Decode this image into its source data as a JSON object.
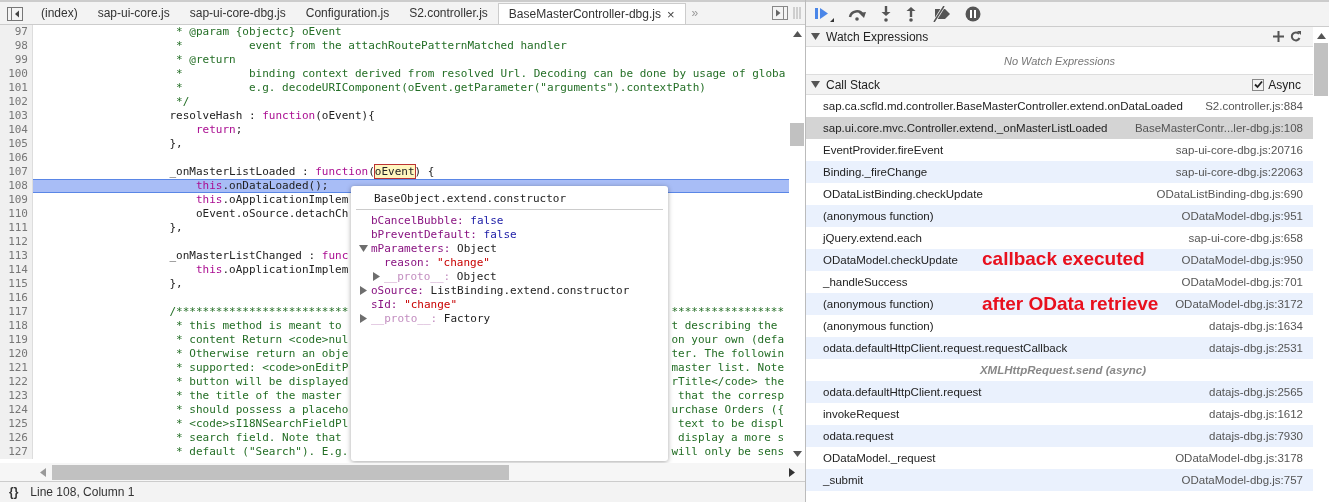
{
  "editor": {
    "tabs": [
      {
        "label": "(index)",
        "selected": false
      },
      {
        "label": "sap-ui-core.js",
        "selected": false
      },
      {
        "label": "sap-ui-core-dbg.js",
        "selected": false
      },
      {
        "label": "Configuration.js",
        "selected": false
      },
      {
        "label": "S2.controller.js",
        "selected": false
      },
      {
        "label": "BaseMasterController-dbg.js",
        "selected": true,
        "close_label": "×"
      }
    ],
    "tab_overflow": "»",
    "lines": [
      {
        "number": "97",
        "highlighted": false,
        "segments": [
          {
            "kind": "comment",
            "text": "                     * @param {objectc} oEvent"
          }
        ]
      },
      {
        "number": "98",
        "highlighted": false,
        "segments": [
          {
            "kind": "comment",
            "text": "                     *          event from the attachRoutePatternMatched handler"
          }
        ]
      },
      {
        "number": "99",
        "highlighted": false,
        "segments": [
          {
            "kind": "comment",
            "text": "                     * @return"
          }
        ]
      },
      {
        "number": "100",
        "highlighted": false,
        "segments": [
          {
            "kind": "comment",
            "text": "                     *          binding context derived from resolved Url. Decoding can be done by usage of globa"
          }
        ]
      },
      {
        "number": "101",
        "highlighted": false,
        "segments": [
          {
            "kind": "comment",
            "text": "                     *          e.g. decodeURIComponent(oEvent.getParameter(\"arguments\").contextPath)"
          }
        ]
      },
      {
        "number": "102",
        "highlighted": false,
        "segments": [
          {
            "kind": "comment",
            "text": "                     */"
          }
        ]
      },
      {
        "number": "103",
        "highlighted": false,
        "segments": [
          {
            "kind": "plain",
            "text": "                    resolveHash : "
          },
          {
            "kind": "keyword",
            "text": "function"
          },
          {
            "kind": "plain",
            "text": "(oEvent){"
          }
        ]
      },
      {
        "number": "104",
        "highlighted": false,
        "segments": [
          {
            "kind": "keyword",
            "text": "                        return"
          },
          {
            "kind": "plain",
            "text": ";"
          }
        ]
      },
      {
        "number": "105",
        "highlighted": false,
        "segments": [
          {
            "kind": "plain",
            "text": "                    },"
          }
        ]
      },
      {
        "number": "106",
        "highlighted": false
      },
      {
        "number": "107",
        "highlighted": false,
        "segments": [
          {
            "kind": "plain",
            "text": "                    _onMasterListLoaded : "
          },
          {
            "kind": "keyword",
            "text": "function"
          },
          {
            "kind": "plain",
            "text": "("
          },
          {
            "kind": "hover",
            "text": "oEvent"
          },
          {
            "kind": "plain",
            "text": ") {"
          }
        ]
      },
      {
        "number": "108",
        "highlighted": true,
        "segments": [
          {
            "kind": "keyword",
            "text": "                        this"
          },
          {
            "kind": "plain",
            "text": ".onDataLoaded();"
          }
        ]
      },
      {
        "number": "109",
        "highlighted": false,
        "segments": [
          {
            "kind": "keyword",
            "text": "                        this"
          },
          {
            "kind": "plain",
            "text": ".oApplicationImplem"
          }
        ]
      },
      {
        "number": "110",
        "highlighted": false,
        "segments": [
          {
            "kind": "plain",
            "text": "                        oEvent.oSource.detachCh"
          }
        ]
      },
      {
        "number": "111",
        "highlighted": false,
        "segments": [
          {
            "kind": "plain",
            "text": "                    },"
          }
        ]
      },
      {
        "number": "112",
        "highlighted": false
      },
      {
        "number": "113",
        "highlighted": false,
        "segments": [
          {
            "kind": "plain",
            "text": "                    _onMasterListChanged : "
          },
          {
            "kind": "keyword",
            "text": "func"
          }
        ]
      },
      {
        "number": "114",
        "highlighted": false,
        "segments": [
          {
            "kind": "keyword",
            "text": "                        this"
          },
          {
            "kind": "plain",
            "text": ".oApplicationImplem"
          }
        ]
      },
      {
        "number": "115",
        "highlighted": false,
        "segments": [
          {
            "kind": "plain",
            "text": "                    },"
          }
        ]
      },
      {
        "number": "116",
        "highlighted": false
      },
      {
        "number": "117",
        "highlighted": false,
        "segments": [
          {
            "kind": "comment",
            "text": "                    /**************************"
          }
        ],
        "right": "*****************"
      },
      {
        "number": "118",
        "highlighted": false,
        "segments": [
          {
            "kind": "comment",
            "text": "                     * this method is meant to"
          }
        ],
        "right": "t describing the"
      },
      {
        "number": "119",
        "highlighted": false,
        "segments": [
          {
            "kind": "comment",
            "text": "                     * content Return <code>nul"
          }
        ],
        "right": "on your own (defa"
      },
      {
        "number": "120",
        "highlighted": false,
        "segments": [
          {
            "kind": "comment",
            "text": "                     * Otherwise return an obje"
          }
        ],
        "right": "ter. The followin"
      },
      {
        "number": "121",
        "highlighted": false,
        "segments": [
          {
            "kind": "comment",
            "text": "                     * supported: <code>onEditP"
          }
        ],
        "right": "master list. Note"
      },
      {
        "number": "122",
        "highlighted": false,
        "segments": [
          {
            "kind": "comment",
            "text": "                     * button will be displayed"
          }
        ],
        "right": "rTitle</code> the"
      },
      {
        "number": "123",
        "highlighted": false,
        "segments": [
          {
            "kind": "comment",
            "text": "                     * the title of the master"
          }
        ],
        "right": " that the corresp"
      },
      {
        "number": "124",
        "highlighted": false,
        "segments": [
          {
            "kind": "comment",
            "text": "                     * should possess a placeho"
          }
        ],
        "right": "urchase Orders ({"
      },
      {
        "number": "125",
        "highlighted": false,
        "segments": [
          {
            "kind": "comment",
            "text": "                     * <code>sI18NSearchFieldPl"
          }
        ],
        "right": " text to be displ"
      },
      {
        "number": "126",
        "highlighted": false,
        "segments": [
          {
            "kind": "comment",
            "text": "                     * search field. Note that"
          }
        ],
        "right": " display a more s"
      },
      {
        "number": "127",
        "highlighted": false,
        "segments": [
          {
            "kind": "comment",
            "text": "                     * default (\"Search\"). E.g."
          }
        ],
        "right": "will only be sens"
      }
    ],
    "popover": {
      "title": "BaseObject.extend.constructor",
      "properties": [
        {
          "name": "bCancelBubble:",
          "value": "false",
          "kind": "boolean",
          "internal": false,
          "expandable": false
        },
        {
          "name": "bPreventDefault:",
          "value": "false",
          "kind": "boolean",
          "internal": false,
          "expandable": false
        },
        {
          "name": "mParameters:",
          "value": "Object",
          "kind": "object",
          "internal": false,
          "expandable": true,
          "expanded": true,
          "children": [
            {
              "name": "reason:",
              "value": "\"change\"",
              "kind": "string",
              "internal": false,
              "expandable": false
            },
            {
              "name": "__proto__:",
              "value": "Object",
              "kind": "object",
              "internal": true,
              "expandable": true,
              "expanded": false
            }
          ]
        },
        {
          "name": "oSource:",
          "value": "ListBinding.extend.constructor",
          "kind": "object",
          "internal": false,
          "expandable": true,
          "expanded": false
        },
        {
          "name": "sId:",
          "value": "\"change\"",
          "kind": "string",
          "internal": false,
          "expandable": false
        },
        {
          "name": "__proto__:",
          "value": "Factory",
          "kind": "object",
          "internal": true,
          "expandable": true,
          "expanded": false
        }
      ]
    },
    "status_bar": {
      "pretty_print": "{}",
      "cursor": "Line 108, Column 1"
    }
  },
  "debugger": {
    "watch": {
      "title": "Watch Expressions",
      "expanded": true,
      "empty_text": "No Watch Expressions"
    },
    "call_stack": {
      "title": "Call Stack",
      "expanded": true,
      "async": {
        "label": "Async",
        "checked": true
      },
      "frames": [
        {
          "kind": "frame",
          "function": "sap.ca.scfld.md.controller.BaseMasterController.extend.onDataLoaded",
          "location": "S2.controller.js:884",
          "selected": false
        },
        {
          "kind": "frame",
          "function": "sap.ui.core.mvc.Controller.extend._onMasterListLoaded",
          "location": "BaseMasterContr...ler-dbg.js:108",
          "selected": true
        },
        {
          "kind": "frame",
          "function": "EventProvider.fireEvent",
          "location": "sap-ui-core-dbg.js:20716",
          "selected": false
        },
        {
          "kind": "frame",
          "function": "Binding._fireChange",
          "location": "sap-ui-core-dbg.js:22063",
          "selected": false
        },
        {
          "kind": "frame",
          "function": "ODataListBinding.checkUpdate",
          "location": "ODataListBinding-dbg.js:690",
          "selected": false
        },
        {
          "kind": "frame",
          "function": "(anonymous function)",
          "location": "ODataModel-dbg.js:951",
          "selected": false
        },
        {
          "kind": "frame",
          "function": "jQuery.extend.each",
          "location": "sap-ui-core-dbg.js:658",
          "selected": false
        },
        {
          "kind": "frame",
          "function": "ODataModel.checkUpdate",
          "location": "ODataModel-dbg.js:950",
          "selected": false
        },
        {
          "kind": "frame",
          "function": "_handleSuccess",
          "location": "ODataModel-dbg.js:701",
          "selected": false
        },
        {
          "kind": "frame",
          "function": "(anonymous function)",
          "location": "ODataModel-dbg.js:3172",
          "selected": false
        },
        {
          "kind": "frame",
          "function": "(anonymous function)",
          "location": "datajs-dbg.js:1634",
          "selected": false
        },
        {
          "kind": "frame",
          "function": "odata.defaultHttpClient.request.requestCallback",
          "location": "datajs-dbg.js:2531",
          "selected": false
        },
        {
          "kind": "async",
          "label": "XMLHttpRequest.send (async)",
          "selected": false
        },
        {
          "kind": "frame",
          "function": "odata.defaultHttpClient.request",
          "location": "datajs-dbg.js:2565",
          "selected": false
        },
        {
          "kind": "frame",
          "function": "invokeRequest",
          "location": "datajs-dbg.js:1612",
          "selected": false
        },
        {
          "kind": "frame",
          "function": "odata.request",
          "location": "datajs-dbg.js:7930",
          "selected": false
        },
        {
          "kind": "frame",
          "function": "ODataModel._request",
          "location": "ODataModel-dbg.js:3178",
          "selected": false
        },
        {
          "kind": "frame",
          "function": "_submit",
          "location": "ODataModel-dbg.js:757",
          "selected": false
        }
      ]
    }
  },
  "annotations": [
    "callback executed",
    "after OData retrieve"
  ]
}
